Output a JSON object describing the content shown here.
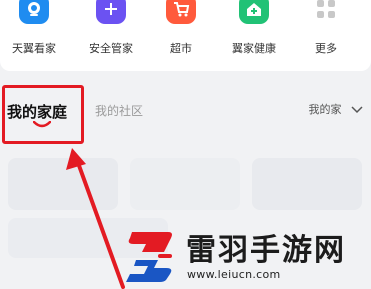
{
  "apps": [
    {
      "label": "天翼看家",
      "icon": "camera-icon",
      "color": "#1f8cf0"
    },
    {
      "label": "安全管家",
      "icon": "shield-plus-icon",
      "color": "#6b52f2"
    },
    {
      "label": "超市",
      "icon": "shopping-cart-icon",
      "color": "#ff5a3c"
    },
    {
      "label": "翼家健康",
      "icon": "home-health-icon",
      "color": "#21c276"
    },
    {
      "label": "更多",
      "icon": "grid-more-icon",
      "color": "#c8c8c8"
    }
  ],
  "tabs": {
    "active": "我的家庭",
    "inactive": "我的社区"
  },
  "home_selector": {
    "label": "我的家"
  },
  "annotation": {
    "highlight_color": "#e31b23"
  },
  "watermark": {
    "title": "雷羽手游网",
    "url": "www.leiucn.com"
  }
}
